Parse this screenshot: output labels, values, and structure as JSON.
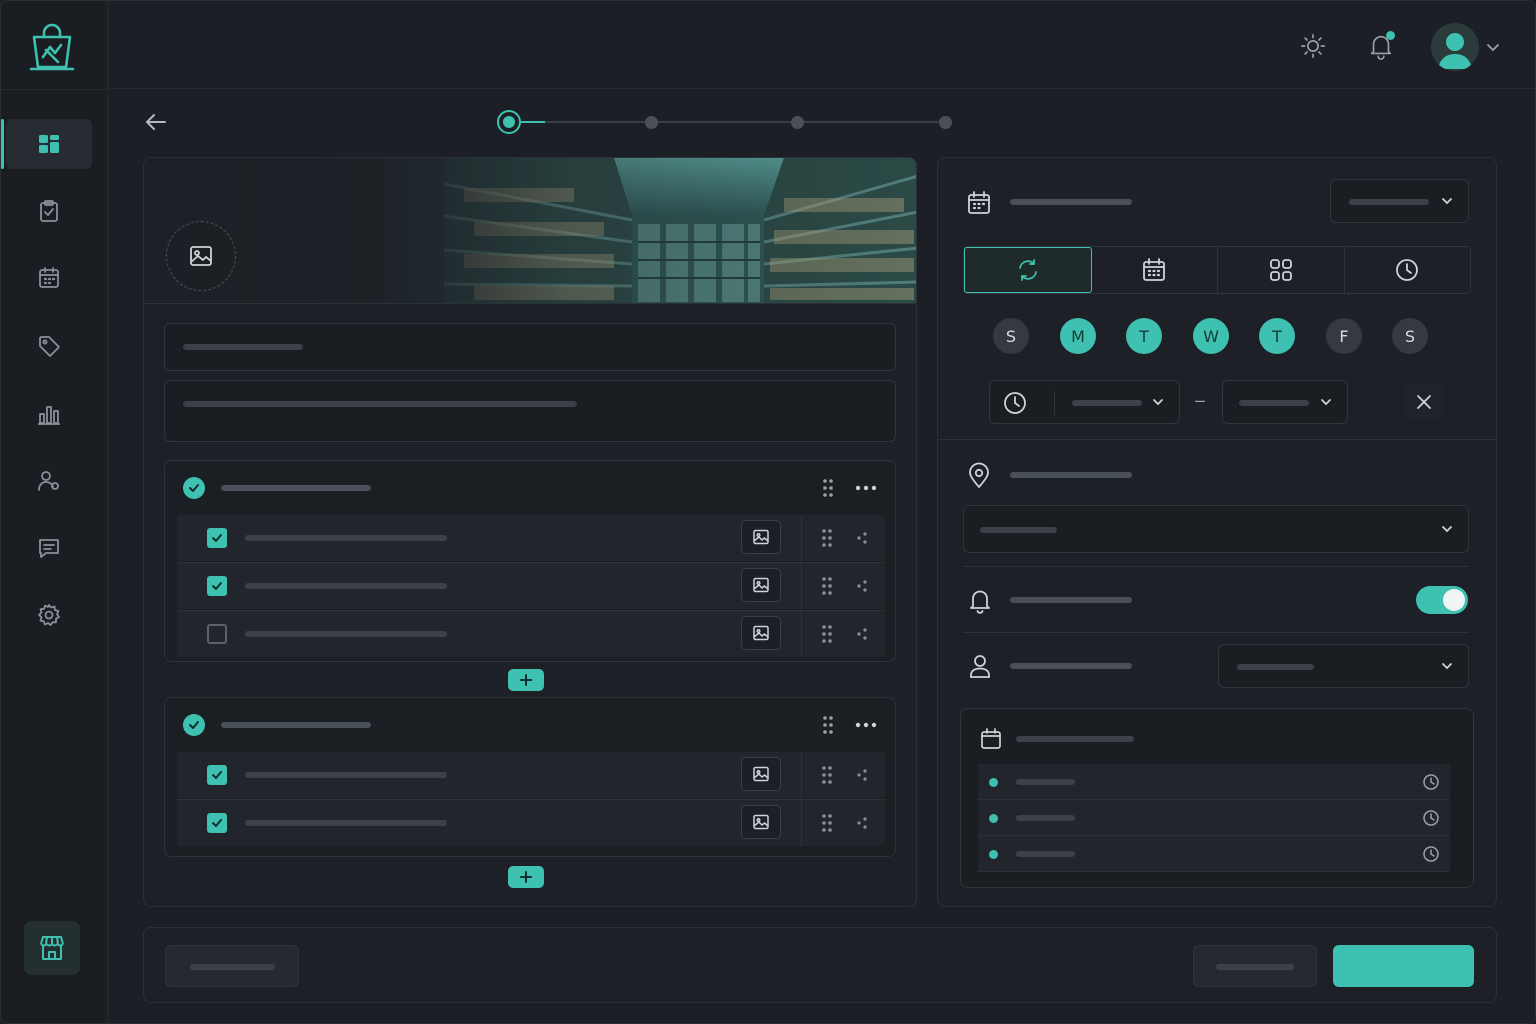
{
  "app": {
    "title": ""
  },
  "colors": {
    "accent": "#3ec1b0",
    "background": "#1c1f25",
    "surface": "#1d2026",
    "muted": "#3c4149"
  },
  "sidebar": {
    "logo": "shopping-bag-logo",
    "items": [
      {
        "icon": "dashboard-grid-icon",
        "active": true
      },
      {
        "icon": "clipboard-check-icon",
        "active": false
      },
      {
        "icon": "calendar-icon",
        "active": false
      },
      {
        "icon": "tag-icon",
        "active": false
      },
      {
        "icon": "bar-chart-icon",
        "active": false
      },
      {
        "icon": "users-icon",
        "active": false
      },
      {
        "icon": "message-icon",
        "active": false
      },
      {
        "icon": "settings-gear-icon",
        "active": false
      }
    ],
    "bottom_icon": "store-icon"
  },
  "topbar": {
    "theme_icon": "sun-icon",
    "notification_icon": "bell-icon",
    "has_unread": true,
    "avatar_icon": "user-avatar"
  },
  "stepper": {
    "total_steps": 4,
    "current_step": 1
  },
  "checklist": {
    "groups": [
      {
        "checked": true,
        "items": [
          {
            "checked": true
          },
          {
            "checked": true
          },
          {
            "checked": false
          }
        ]
      },
      {
        "checked": true,
        "items": [
          {
            "checked": true
          },
          {
            "checked": true
          }
        ]
      }
    ],
    "add_label": "+"
  },
  "schedule": {
    "segments": [
      "repeat-icon",
      "calendar-icon",
      "grid-icon",
      "clock-icon"
    ],
    "active_segment": 0,
    "days": [
      {
        "label": "S",
        "on": false
      },
      {
        "label": "M",
        "on": true
      },
      {
        "label": "T",
        "on": true
      },
      {
        "label": "W",
        "on": true
      },
      {
        "label": "T",
        "on": true
      },
      {
        "label": "F",
        "on": false
      },
      {
        "label": "S",
        "on": false
      }
    ],
    "time_separator": "–",
    "notifications_enabled": true
  }
}
